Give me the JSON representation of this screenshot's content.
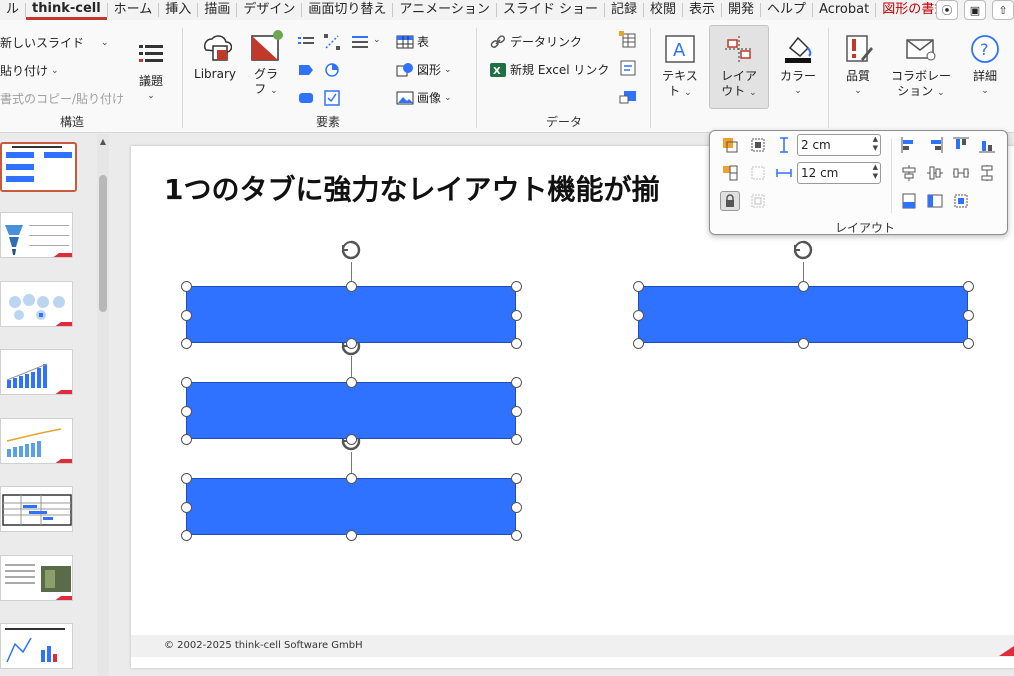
{
  "tabs": [
    {
      "label": "ル"
    },
    {
      "label": "think-cell",
      "active": true
    },
    {
      "label": "ホーム"
    },
    {
      "label": "挿入"
    },
    {
      "label": "描画"
    },
    {
      "label": "デザイン"
    },
    {
      "label": "画面切り替え"
    },
    {
      "label": "アニメーション"
    },
    {
      "label": "スライド ショー"
    },
    {
      "label": "記録"
    },
    {
      "label": "校閲"
    },
    {
      "label": "表示"
    },
    {
      "label": "開発"
    },
    {
      "label": "ヘルプ"
    },
    {
      "label": "Acrobat"
    },
    {
      "label": "図形の書式",
      "shape": true
    }
  ],
  "ribbon": {
    "structure": {
      "new_slide": "新しいスライド",
      "paste": "貼り付け",
      "copy_paste_format": "書式のコピー/貼り付け",
      "agenda": "議題",
      "group_label": "構造"
    },
    "elements": {
      "library": "Library",
      "graph": "グラ",
      "graph_sub": "フ",
      "table": "表",
      "shape": "図形",
      "image": "画像",
      "group_label": "要素"
    },
    "data": {
      "data_link": "データリンク",
      "new_excel_link": "新規 Excel リンク",
      "group_label": "データ"
    },
    "text": {
      "label1": "テキス",
      "label2": "ト"
    },
    "layout": {
      "label1": "レイア",
      "label2": "ウト"
    },
    "color": {
      "label": "カラー"
    },
    "quality": {
      "label": "品質"
    },
    "collab": {
      "label1": "コラボレー",
      "label2": "ション"
    },
    "details": {
      "label": "詳細"
    }
  },
  "layout_popup": {
    "height_value": "2 cm",
    "width_value": "12 cm",
    "label": "レイアウト"
  },
  "slide": {
    "title": "1つのタブに強力なレイアウト機能が揃",
    "footer": "© 2002-2025 think-cell Software GmbH"
  },
  "colors": {
    "accent": "#c0392b",
    "shape_fill": "#2f72ff",
    "shape_tab": "#c00000",
    "corner": "#e02b3a"
  }
}
